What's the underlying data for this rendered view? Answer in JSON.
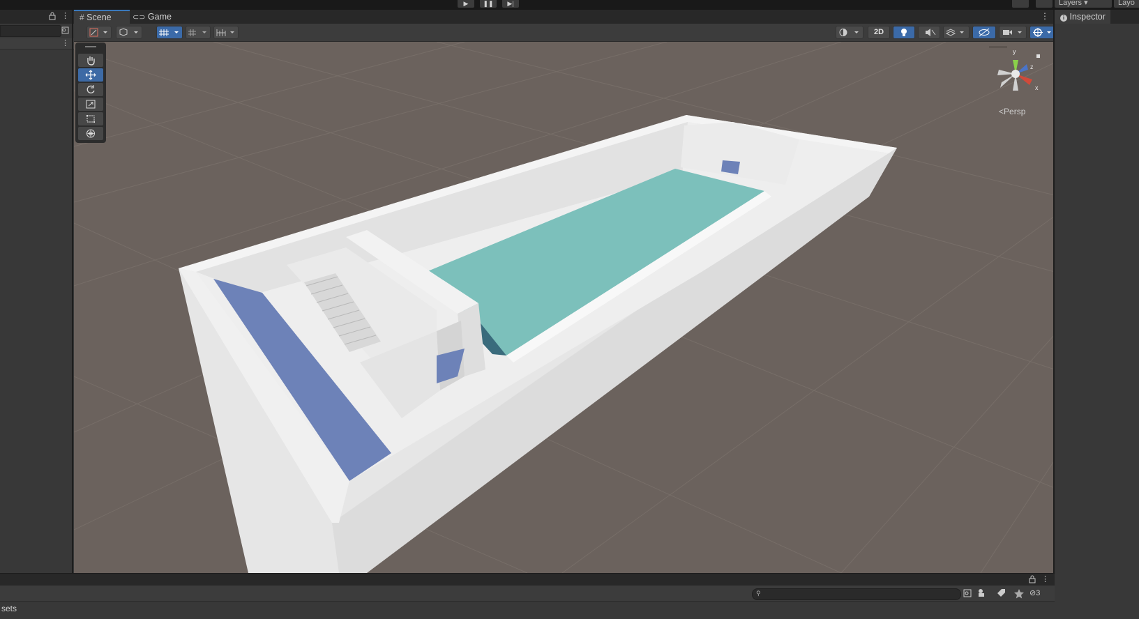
{
  "toolbar_top": {
    "layers_label": "Layers",
    "layout_label": "Layo"
  },
  "scene_view": {
    "tabs": [
      {
        "label": "Scene",
        "icon": "grid-hash-icon",
        "active": true
      },
      {
        "label": "Game",
        "icon": "gamepad-icon",
        "active": false
      }
    ],
    "toggle_2d_label": "2D",
    "projection_label": "Persp",
    "gizmo_axes": {
      "y": "y",
      "z": "z",
      "x": "x"
    }
  },
  "inspector": {
    "title": "Inspector",
    "icon": "info-icon"
  },
  "project_panel": {
    "breadcrumb": "sets",
    "hidden_count": "3"
  },
  "colors": {
    "accent": "#3a79bb",
    "viewport_bg": "#6b625d",
    "water": "#7cc0bb",
    "wall": "#ececec"
  }
}
